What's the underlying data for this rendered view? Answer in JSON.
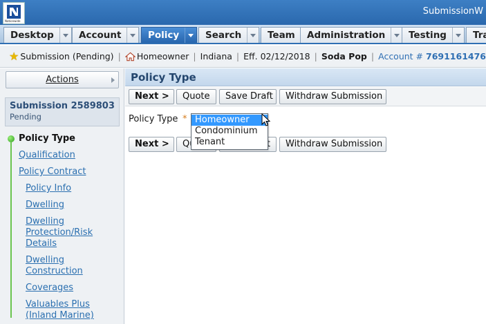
{
  "app": {
    "title": "SubmissionW",
    "logo_text": "Nationwide"
  },
  "tabs": [
    {
      "label": "Desktop",
      "has_menu": true,
      "active": false
    },
    {
      "label": "Account",
      "has_menu": true,
      "active": false
    },
    {
      "label": "Policy",
      "has_menu": true,
      "active": true
    },
    {
      "label": "Search",
      "has_menu": true,
      "active": false
    },
    {
      "label": "Team",
      "has_menu": false,
      "active": false
    },
    {
      "label": "Administration",
      "has_menu": true,
      "active": false
    },
    {
      "label": "Testing",
      "has_menu": true,
      "active": false
    },
    {
      "label": "Tra",
      "has_menu": false,
      "active": false
    }
  ],
  "infobar": {
    "submission_status": "Submission (Pending)",
    "product": "Homeowner",
    "state": "Indiana",
    "effective": "Eff. 02/12/2018",
    "insured": "Soda Pop",
    "account_label": "Account #",
    "account_number": "7691161476"
  },
  "sidebar": {
    "actions_label": "Actions",
    "submission_title": "Submission 2589803",
    "submission_status": "Pending",
    "nav": [
      {
        "label": "Policy Type",
        "current": true
      },
      {
        "label": "Qualification",
        "current": false
      },
      {
        "label": "Policy Contract",
        "current": false
      },
      {
        "label": "Policy Info",
        "current": false
      },
      {
        "label": "Dwelling",
        "current": false
      },
      {
        "label": "Dwelling Protection/Risk Details",
        "current": false
      },
      {
        "label": "Dwelling Construction",
        "current": false
      },
      {
        "label": "Coverages",
        "current": false
      },
      {
        "label": "Valuables Plus (Inland Marine)",
        "current": false
      }
    ]
  },
  "main": {
    "page_title": "Policy Type",
    "buttons": {
      "next": "Next >",
      "quote": "Quote",
      "save_draft": "Save Draft",
      "withdraw": "Withdraw Submission"
    },
    "field_label": "Policy Type",
    "required_marker": "*",
    "dropdown": {
      "selected": "Homeowner",
      "options": [
        "Homeowner",
        "Condominium",
        "Tenant"
      ]
    },
    "bottom_partial": {
      "quote_fragment": "Qu",
      "save_fragment": "t"
    }
  },
  "colors": {
    "accent": "#2f6fb3",
    "link": "#2a6fb0",
    "selection": "#3399ff",
    "required": "#d67c1c"
  }
}
